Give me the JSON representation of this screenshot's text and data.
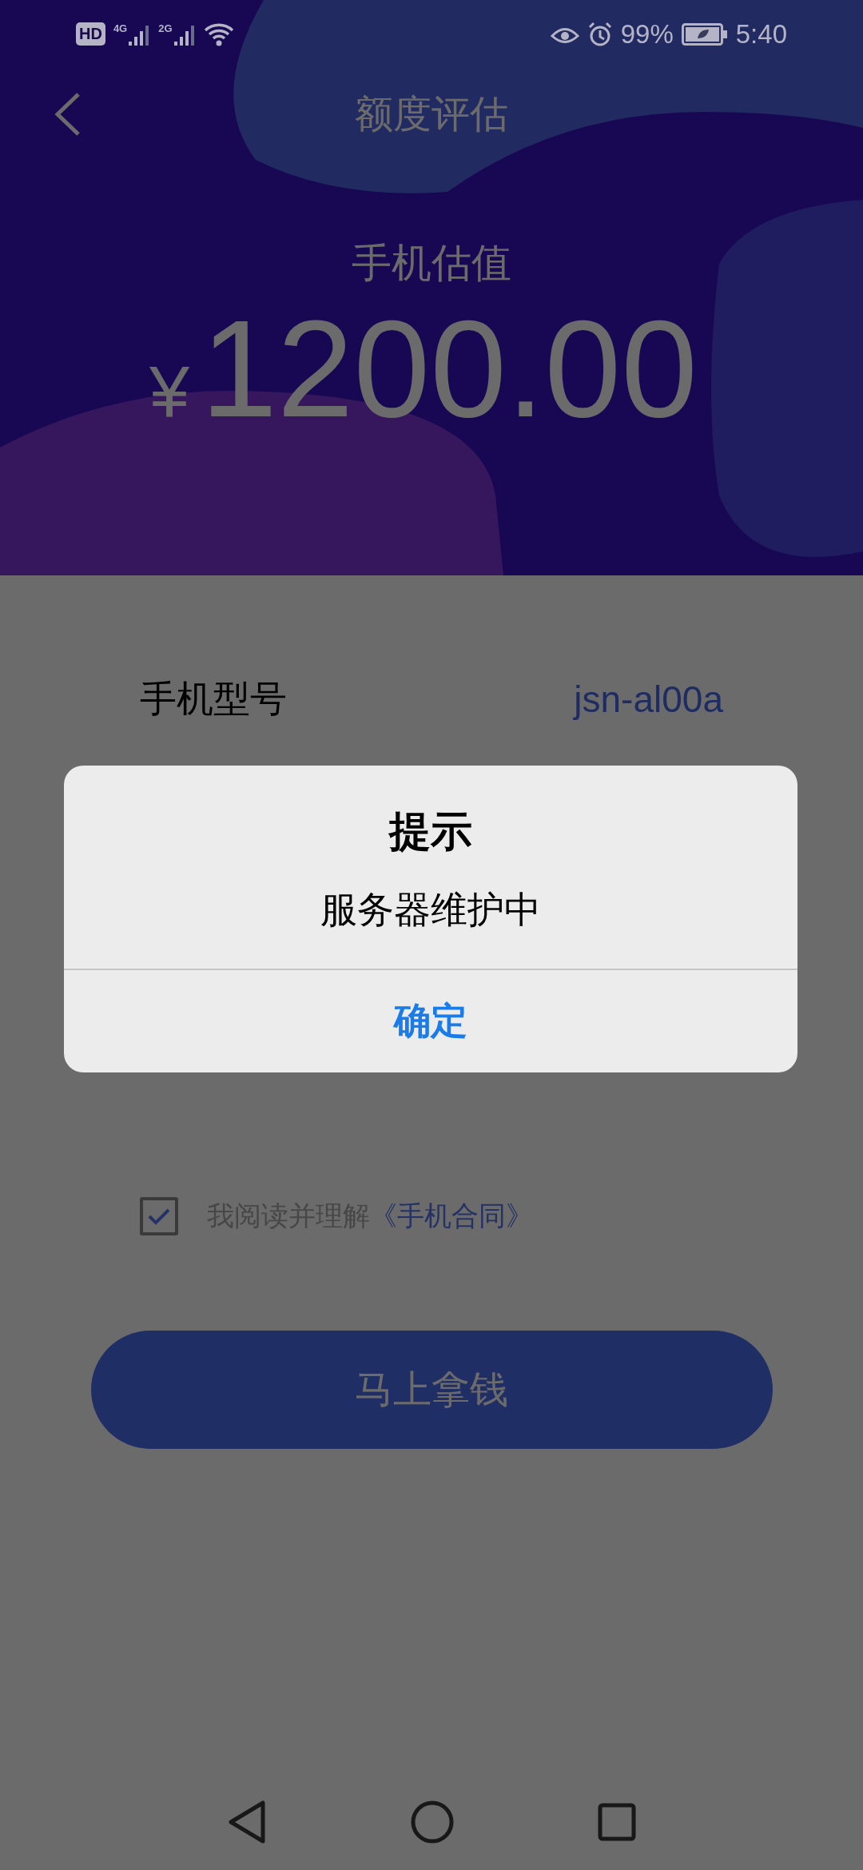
{
  "status_bar": {
    "hd": "HD",
    "networks": [
      "4G",
      "2G"
    ],
    "battery": "99%",
    "time": "5:40"
  },
  "header": {
    "title": "额度评估"
  },
  "valuation": {
    "label": "手机估值",
    "currency": "¥",
    "amount": "1200.00"
  },
  "rows": [
    {
      "label": "手机型号",
      "value": "jsn-al00a"
    }
  ],
  "agreement": {
    "checked": true,
    "text": "我阅读并理解",
    "link": "《手机合同》"
  },
  "primary_button": {
    "label": "马上拿钱"
  },
  "dialog": {
    "title": "提示",
    "message": "服务器维护中",
    "button": "确定"
  }
}
